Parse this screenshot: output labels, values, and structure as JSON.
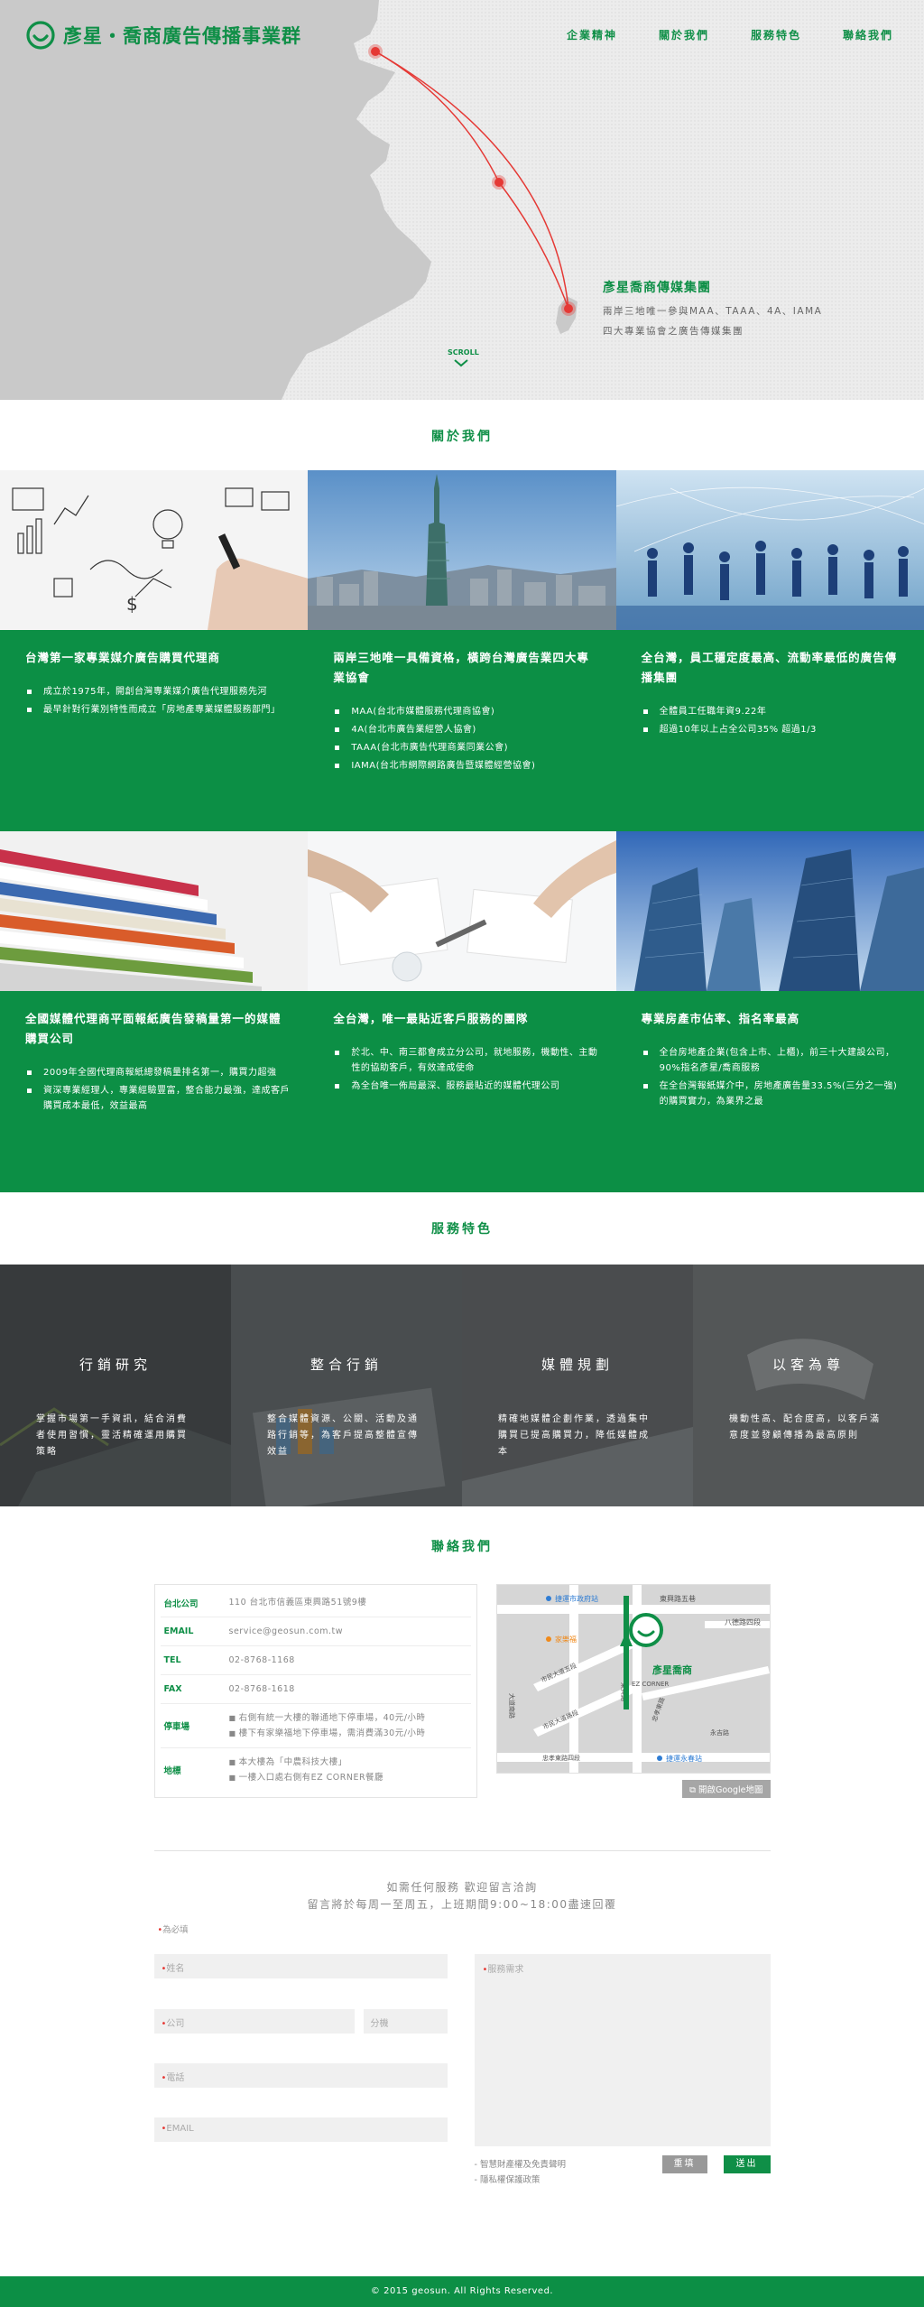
{
  "header": {
    "logo_text": "彥星‧喬商廣告傳播事業群",
    "nav": [
      "企業精神",
      "關於我們",
      "服務特色",
      "聯絡我們"
    ]
  },
  "hero": {
    "title": "彥星喬商傳媒集團",
    "line1": "兩岸三地唯一參與MAA、TAAA、4A、IAMA",
    "line2": "四大專業協會之廣告傳媒集團",
    "scroll": "SCROLL"
  },
  "about": {
    "title": "關於我們",
    "cards": [
      {
        "heading": "台灣第一家專業媒介廣告購買代理商",
        "items": [
          "成立於1975年，開創台灣專業媒介廣告代理服務先河",
          "最早針對行業別特性而成立「房地產專業媒體服務部門」"
        ],
        "image_label": "business-sketch-photo"
      },
      {
        "heading": "兩岸三地唯一具備資格，橫跨台灣廣告業四大專業協會",
        "items": [
          "MAA(台北市媒體服務代理商協會)",
          "4A(台北市廣告業經營人協會)",
          "TAAA(台北市廣告代理商業同業公會)",
          "IAMA(台北市網際網路廣告暨媒體經營協會)"
        ],
        "image_label": "taipei-101-photo"
      },
      {
        "heading": "全台灣，員工穩定度最高、流動率最低的廣告傳播集團",
        "items": [
          "全體員工任職年資9.22年",
          "超過10年以上占全公司35% 超過1/3"
        ],
        "image_label": "team-celebration-photo"
      },
      {
        "heading": "全國媒體代理商平面報紙廣告發稿量第一的媒體購買公司",
        "items": [
          "2009年全國代理商報紙總發稿量排名第一，購買力超強",
          "資深專業經理人，專業經驗豐富，整合能力最強，達成客戶購買成本最低，效益最高"
        ],
        "image_label": "magazines-photo"
      },
      {
        "heading": "全台灣，唯一最貼近客戶服務的團隊",
        "items": [
          "於北、中、南三都會成立分公司，就地服務，機動性、主動性的協助客戶，有效達成使命",
          "為全台唯一佈局最深、服務最貼近的媒體代理公司"
        ],
        "image_label": "meeting-desk-photo"
      },
      {
        "heading": "專業房產市佔率、指名率最高",
        "items": [
          "全台房地產企業(包含上市、上櫃)，前三十大建設公司，90%指名彥星/喬商服務",
          "在全台灣報紙媒介中，房地產廣告量33.5%(三分之一強)的購買實力，為業界之最"
        ],
        "image_label": "skyscrapers-photo"
      }
    ]
  },
  "services": {
    "title": "服務特色",
    "items": [
      {
        "title": "行銷研究",
        "desc": "掌握市場第一手資訊，結合消費者使用習慣，靈活精確運用購買策略"
      },
      {
        "title": "整合行銷",
        "desc": "整合媒體資源、公關、活動及通路行銷等，為客戶提高整體宣傳效益"
      },
      {
        "title": "媒體規劃",
        "desc": "精確地媒體企劃作業，透過集中購買已提高購買力，降低媒體成本"
      },
      {
        "title": "以客為尊",
        "desc": "機動性高、配合度高，以客戶滿意度並發顧傳播為最高原則"
      }
    ]
  },
  "contact": {
    "title": "聯絡我們",
    "rows": [
      {
        "key": "台北公司",
        "value": "110 台北市信義區東興路51號9樓"
      },
      {
        "key": "EMAIL",
        "value": "service@geosun.com.tw"
      },
      {
        "key": "TEL",
        "value": "02-8768-1168"
      },
      {
        "key": "FAX",
        "value": "02-8768-1618"
      }
    ],
    "parking": {
      "key": "停車場",
      "lines": [
        "右側有統一大樓的聯通地下停車場，40元/小時",
        "樓下有家樂福地下停車場，需消費滿30元/小時"
      ]
    },
    "landmark": {
      "key": "地標",
      "lines": [
        "本大樓為「中農科技大樓」",
        "一樓入口處右側有EZ CORNER餐廳"
      ]
    },
    "map": {
      "labels": {
        "mrt1": "捷運市政府站",
        "road1": "東興路五巷",
        "road2": "八德路四段",
        "carrefour": "家樂福",
        "road3": "市民大道五段",
        "road4": "大道南路",
        "road5": "東興路",
        "company": "彥星喬商",
        "ezcorner": "EZ CORNER",
        "road6": "市民大道路段",
        "road7": "忠孝東路",
        "road8": "永吉路",
        "road9": "忠孝東路四段",
        "mrt2": "捷運永春站"
      },
      "button": "開啟Google地圖"
    }
  },
  "form": {
    "intro_line1": "如需任何服務 歡迎留言洽詢",
    "intro_line2": "留言將於每周一至周五，上班期間9:00~18:00盡速回覆",
    "required_note": "為必填",
    "name_placeholder": "姓名",
    "company_placeholder": "公司",
    "ext_placeholder": "分機",
    "phone_placeholder": "電話",
    "email_placeholder": "EMAIL",
    "message_placeholder": "服務需求",
    "note1": "- 智慧財產權及免責聲明",
    "note2": "- 隱私權保護政策",
    "clear": "重填",
    "submit": "送出"
  },
  "footer": {
    "copyright": "© 2015 geosun. All Rights Reserved."
  },
  "colors": {
    "brand_green": "#0f8f47",
    "route_red": "#e53935"
  }
}
